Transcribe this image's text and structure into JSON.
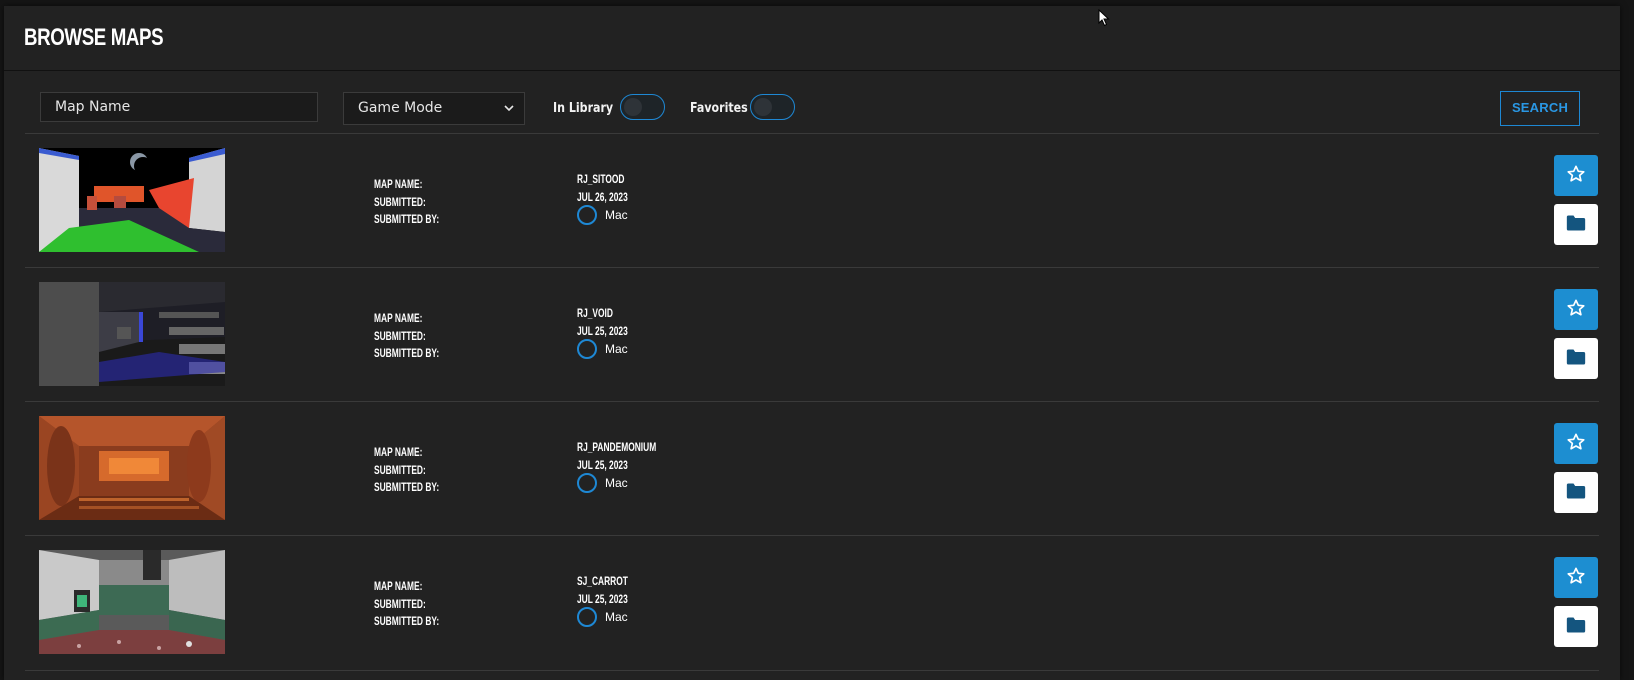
{
  "header": {
    "title": "BROWSE MAPS"
  },
  "filters": {
    "map_name_value": "Map Name",
    "game_mode_value": "Game Mode",
    "in_library_label": "In Library",
    "favorites_label": "Favorites",
    "search_label": "SEARCH",
    "in_library_on": false,
    "favorites_on": false
  },
  "labels": {
    "map_name": "MAP NAME:",
    "submitted": "SUBMITTED:",
    "submitted_by": "SUBMITTED BY:"
  },
  "maps": [
    {
      "name": "RJ_SITOOD",
      "submitted": "JUL 26, 2023",
      "submitted_by": "Mac"
    },
    {
      "name": "RJ_VOID",
      "submitted": "JUL 25, 2023",
      "submitted_by": "Mac"
    },
    {
      "name": "RJ_PANDEMONIUM",
      "submitted": "JUL 25, 2023",
      "submitted_by": "Mac"
    },
    {
      "name": "SJ_CARROT",
      "submitted": "JUL 25, 2023",
      "submitted_by": "Mac"
    }
  ],
  "icons": {
    "favorite": "star-outline-icon",
    "library": "folder-icon",
    "dropdown": "chevron-down-icon"
  },
  "colors": {
    "accent": "#1d8ed1",
    "background": "#222222",
    "folder_icon": "#14557f"
  }
}
